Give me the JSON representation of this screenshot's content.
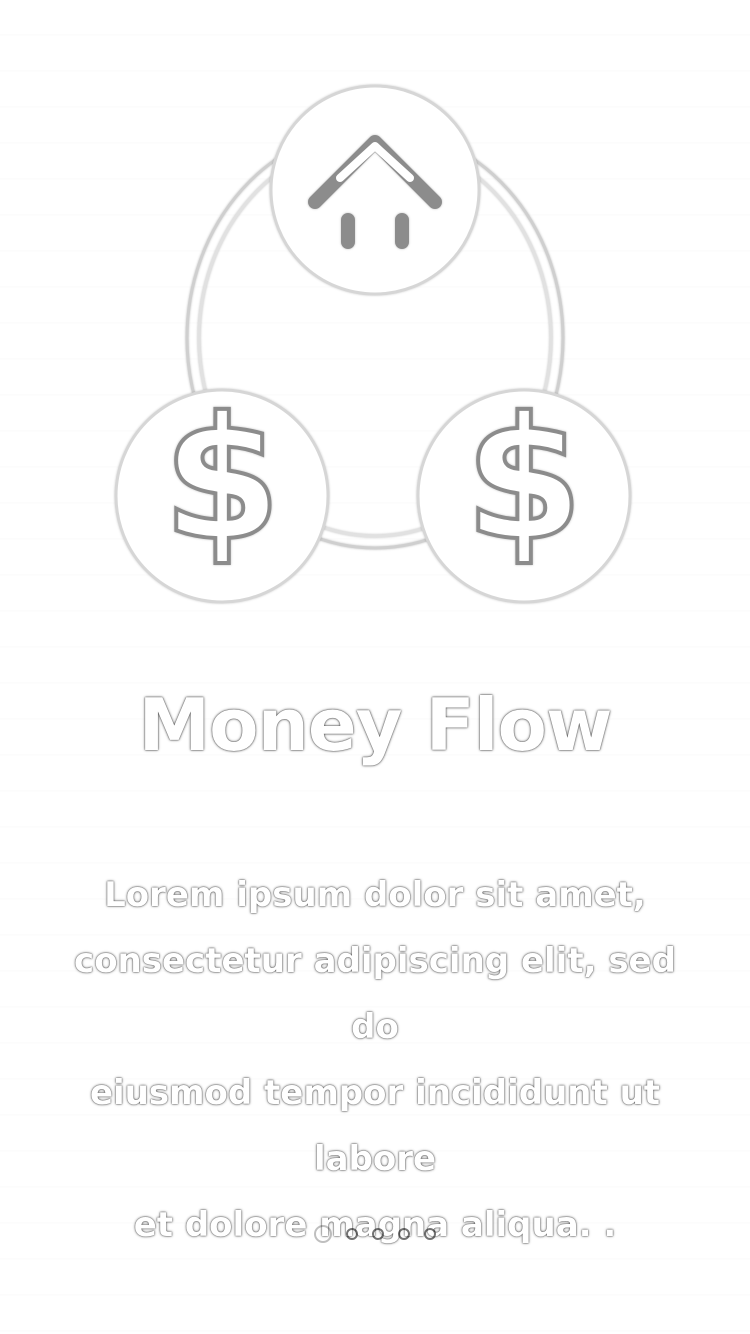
{
  "onboarding": {
    "title": "Money Flow",
    "description_lines": [
      "Lorem ipsum dolor sit amet,",
      "consectetur adipiscing elit, sed do",
      "eiusmod tempor incididunt ut labore",
      "et dolore magna aliqua. ."
    ],
    "pager": {
      "active_index": 0,
      "count": 5
    },
    "icons": {
      "top": "up-arrows-icon",
      "left": "dollar-icon",
      "right": "dollar-icon"
    }
  }
}
